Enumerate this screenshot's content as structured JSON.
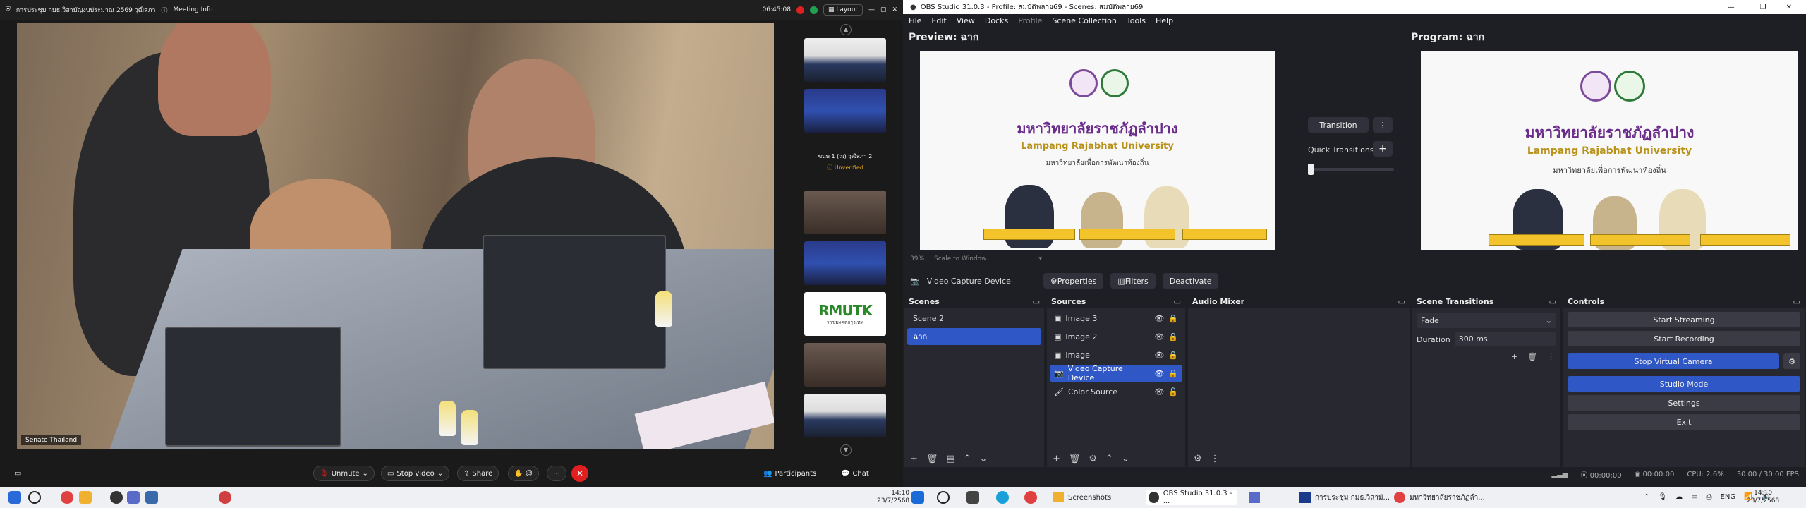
{
  "zoom": {
    "title": "การประชุม กมธ.วิสามัญงบประมาณ 2569 วุฒิสภา",
    "meeting_info": "Meeting Info",
    "timer": "06:45:08",
    "layout": "Layout",
    "speaker": "Senate Thailand",
    "thumb_user_name": "ขนพ 1 (ณ) วุฒิสภา 2",
    "thumb_unverified": "Unverified",
    "thumb_logo_text": "RMUTK",
    "thumb_logo_sub": "ราชมงคลกรุงเทพ",
    "toolbar": {
      "unmute": "Unmute",
      "stop_video": "Stop video",
      "share": "Share",
      "participants": "Participants",
      "chat": "Chat"
    }
  },
  "taskbar": {
    "items": [
      "Screenshots",
      "OBS Studio 31.0.3 - ...",
      "การประชุม กมธ.วิสามั...",
      "มหาวิทยาลัยราชภัฏลำ..."
    ],
    "lang": "ENG",
    "time_left": "14:10",
    "date_left": "23/7/2568",
    "time_right": "14:10",
    "date_right": "23/7/2568"
  },
  "obs": {
    "title": "OBS Studio 31.0.3 - Profile: สมบัติพลาย69 - Scenes: สมบัติพลาย69",
    "menu": [
      "File",
      "Edit",
      "View",
      "Docks",
      "Profile",
      "Scene Collection",
      "Tools",
      "Help"
    ],
    "preview_label": "Preview: ฉาก",
    "program_label": "Program: ฉาก",
    "zoom_level": "39%",
    "scale_mode": "Scale to Window",
    "transition": "Transition",
    "quick_transitions": "Quick Transitions",
    "source_bar": {
      "name": "Video Capture Device",
      "properties": "Properties",
      "filters": "Filters",
      "deactivate": "Deactivate"
    },
    "scenes": {
      "title": "Scenes",
      "items": [
        "Scene 2",
        "ฉาก"
      ]
    },
    "sources": {
      "title": "Sources",
      "items": [
        "Image 3",
        "Image 2",
        "Image",
        "Video Capture Device",
        "Color Source"
      ]
    },
    "audio_mixer": {
      "title": "Audio Mixer"
    },
    "transitions": {
      "title": "Scene Transitions",
      "type": "Fade",
      "duration_label": "Duration",
      "duration": "300 ms"
    },
    "controls": {
      "title": "Controls",
      "start_streaming": "Start Streaming",
      "start_recording": "Start Recording",
      "stop_virtual_camera": "Stop Virtual Camera",
      "studio_mode": "Studio Mode",
      "settings": "Settings",
      "exit": "Exit"
    },
    "status": {
      "stream_time": "00:00:00",
      "rec_time": "00:00:00",
      "cpu": "CPU: 2.6%",
      "fps": "30.00 / 30.00 FPS"
    }
  },
  "slide": {
    "thai_name": "มหาวิทยาลัยราชภัฏลำปาง",
    "english_name": "Lampang Rajabhat University",
    "subtitle": "มหาวิทยาลัยเพื่อการพัฒนาท้องถิ่น"
  },
  "colors": {
    "obs_accent": "#2f57c6",
    "zoom_leave": "#e02020",
    "slide_purple": "#6a2b8b",
    "slide_gold": "#b8921a"
  }
}
